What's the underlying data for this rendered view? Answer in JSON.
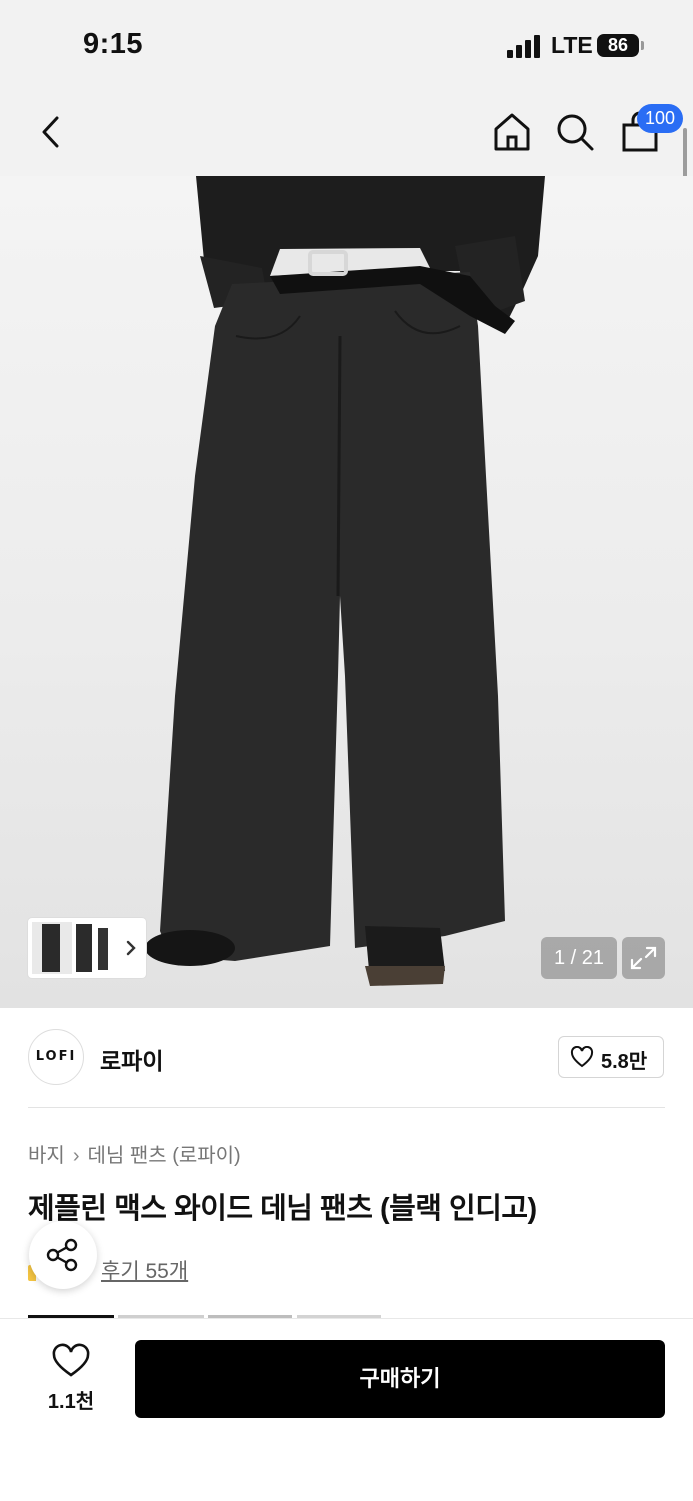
{
  "status_bar": {
    "time": "9:15",
    "network": "LTE",
    "battery": "86"
  },
  "nav": {
    "cart_count": "100",
    "icons": [
      "back-icon",
      "home-icon",
      "search-icon",
      "shopping-bag-icon"
    ]
  },
  "gallery": {
    "counter": "1 / 21"
  },
  "brand": {
    "logo_text": "LOFI",
    "name": "로파이",
    "likes": "5.8만"
  },
  "breadcrumb": [
    "바지",
    "데님 팬츠 (로파이)"
  ],
  "product": {
    "title": "제플린 맥스 와이드 데님 팬츠 (블랙 인디고)",
    "reviews": "후기 55개"
  },
  "bottom": {
    "wish_count": "1.1천",
    "buy_label": "구매하기"
  },
  "colors": {
    "accent_badge": "#2a6df4",
    "buy_button": "#000000"
  }
}
